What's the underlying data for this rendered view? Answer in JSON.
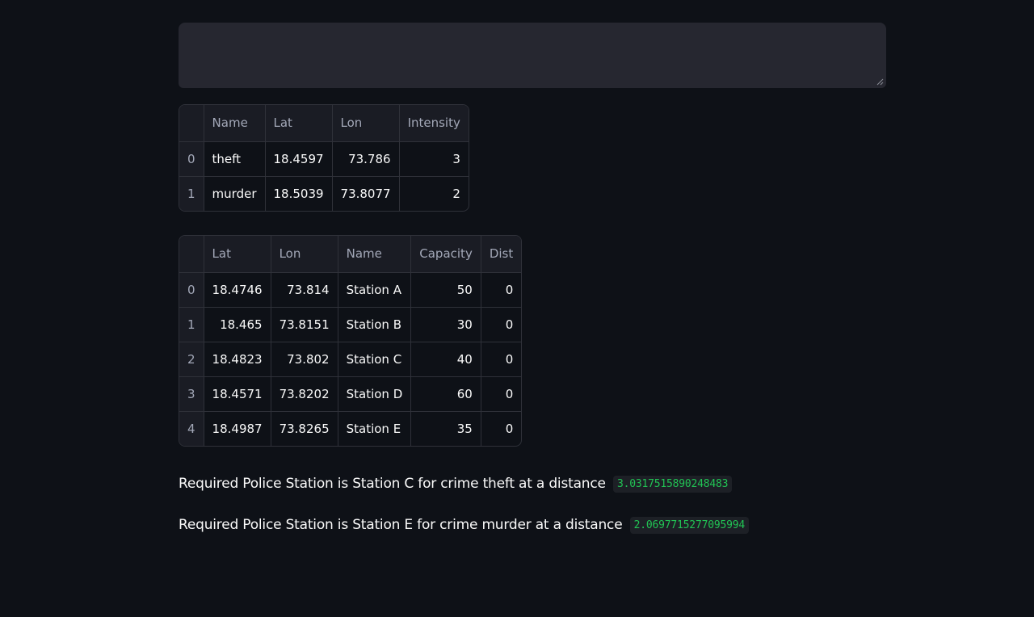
{
  "textarea": {
    "value": ""
  },
  "crimes_table": {
    "columns": [
      "",
      "Name",
      "Lat",
      "Lon",
      "Intensity"
    ],
    "column_align": [
      "idx",
      "txt",
      "num",
      "num",
      "num"
    ],
    "rows": [
      [
        "0",
        "theft",
        "18.4597",
        "73.786",
        "3"
      ],
      [
        "1",
        "murder",
        "18.5039",
        "73.8077",
        "2"
      ]
    ]
  },
  "stations_table": {
    "columns": [
      "",
      "Lat",
      "Lon",
      "Name",
      "Capacity",
      "Dist"
    ],
    "column_align": [
      "idx",
      "num",
      "num",
      "txt",
      "num",
      "num"
    ],
    "rows": [
      [
        "0",
        "18.4746",
        "73.814",
        "Station A",
        "50",
        "0"
      ],
      [
        "1",
        "18.465",
        "73.8151",
        "Station B",
        "30",
        "0"
      ],
      [
        "2",
        "18.4823",
        "73.802",
        "Station C",
        "40",
        "0"
      ],
      [
        "3",
        "18.4571",
        "73.8202",
        "Station D",
        "60",
        "0"
      ],
      [
        "4",
        "18.4987",
        "73.8265",
        "Station E",
        "35",
        "0"
      ]
    ]
  },
  "results": [
    {
      "text": "Required Police Station is Station C for crime theft at a distance",
      "distance": "3.0317515890248483"
    },
    {
      "text": "Required Police Station is Station E for crime murder at a distance",
      "distance": "2.0697715277095994"
    }
  ],
  "colors": {
    "background": "#0e1117",
    "code_text": "#21c354",
    "table_header": "#1a1c24"
  }
}
